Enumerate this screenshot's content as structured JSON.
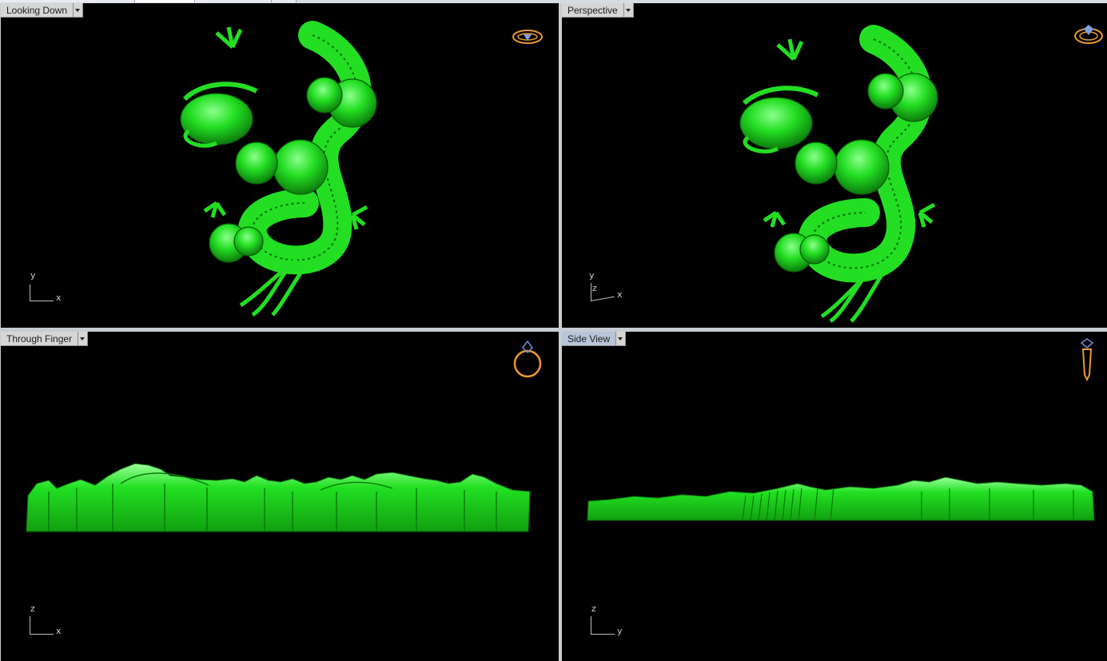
{
  "viewports": {
    "top": {
      "title": "Looking Down",
      "active": false,
      "axes": {
        "v": "y",
        "h": "x"
      }
    },
    "persp": {
      "title": "Perspective",
      "active": false,
      "axes": {
        "v": "y",
        "z": "z",
        "h": "x"
      }
    },
    "front": {
      "title": "Through Finger",
      "active": false,
      "axes": {
        "v": "z",
        "h": "x"
      }
    },
    "right": {
      "title": "Side View",
      "active": true,
      "axes": {
        "v": "z",
        "h": "y"
      }
    }
  },
  "icons": {
    "top": "ring-top-icon",
    "persp": "ring-perspective-icon",
    "front": "ring-front-icon",
    "right": "ring-side-icon"
  },
  "colors": {
    "model": "#22e022",
    "model_dark": "#0c7d0c",
    "model_light": "#9cff9c",
    "background": "#000000",
    "icon": "#e89a2e"
  }
}
